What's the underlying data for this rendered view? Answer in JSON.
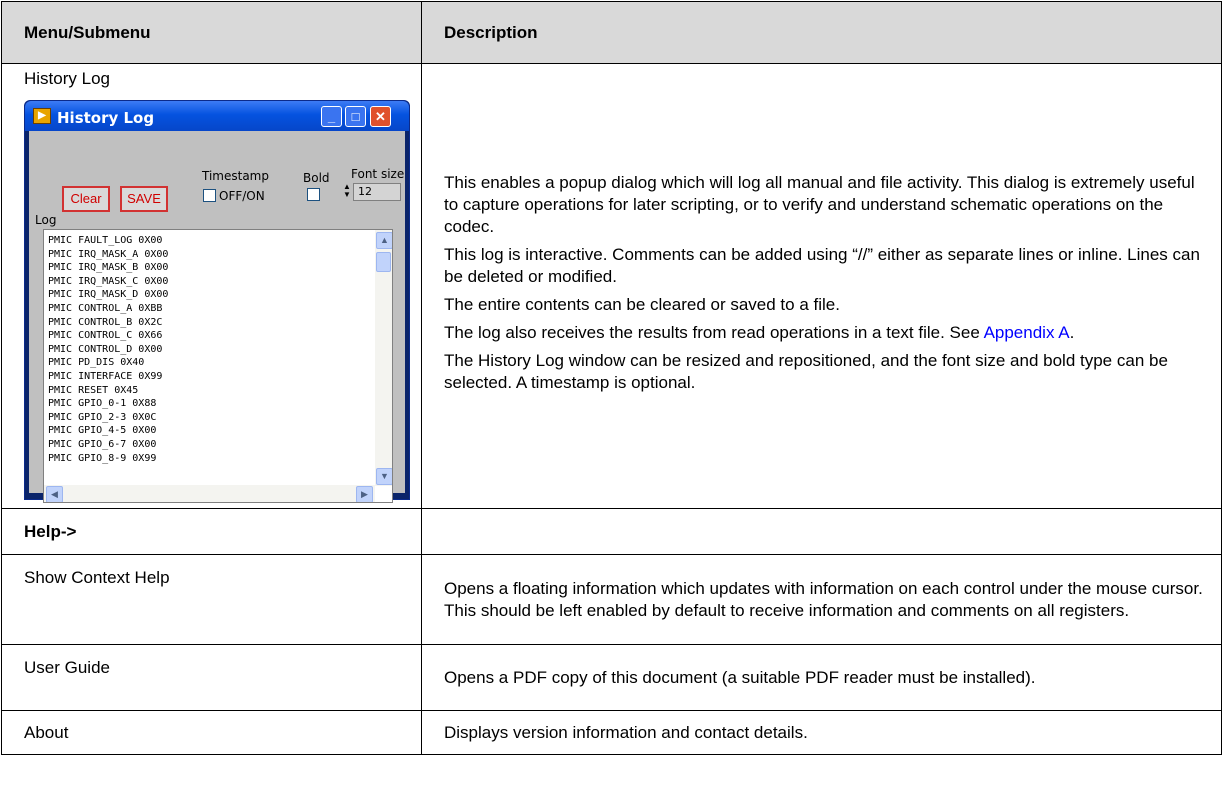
{
  "table": {
    "header": {
      "col1": "Menu/Submenu",
      "col2": "Description"
    },
    "history_row": {
      "label": "History Log",
      "paragraphs": [
        "This enables a popup dialog which will log all manual and file activity. This dialog is extremely useful to capture operations for later scripting, or to verify and understand schematic operations on the codec.",
        "This log is interactive. Comments can be added using “//” either as separate lines or inline. Lines can be deleted or modified.",
        "The entire contents can be cleared or saved to a file."
      ],
      "para4_text": "The log also receives the results from read operations in a text file. See ",
      "para4_link": "Appendix A",
      "para4_end": ".",
      "para5": "The History Log window can be resized and repositioned, and the font size and bold type can be selected. A timestamp is optional."
    },
    "help_row": {
      "label": "Help->"
    },
    "context_row": {
      "label": "Show Context Help",
      "description": "Opens a floating information which updates with information on each control under the mouse cursor. This should be left enabled by default to receive information and comments on all registers."
    },
    "guide_row": {
      "label": "User Guide",
      "description": "Opens a PDF copy of this document (a suitable PDF reader must be installed)."
    },
    "about_row": {
      "label": "About",
      "description": "Displays version information and contact details."
    }
  },
  "window": {
    "title": "History Log",
    "clear_label": "Clear",
    "save_label": "SAVE",
    "timestamp_label": "Timestamp",
    "offon_label": "OFF/ON",
    "bold_label": "Bold",
    "fontsize_label": "Font size",
    "fontsize_value": "12",
    "log_label": "Log",
    "log_lines": [
      "PMIC FAULT_LOG 0X00",
      "PMIC IRQ_MASK_A 0X00",
      "PMIC IRQ_MASK_B 0X00",
      "PMIC IRQ_MASK_C 0X00",
      "PMIC IRQ_MASK_D 0X00",
      "PMIC CONTROL_A 0XBB",
      "PMIC CONTROL_B 0X2C",
      "PMIC CONTROL_C 0X66",
      "PMIC CONTROL_D 0X00",
      "PMIC PD_DIS 0X40",
      "PMIC INTERFACE 0X99",
      "PMIC RESET 0X45",
      "PMIC GPIO_0-1 0X88",
      "PMIC GPIO_2-3 0X0C",
      "PMIC GPIO_4-5 0X00",
      "PMIC GPIO_6-7 0X00",
      "PMIC GPIO_8-9 0X99"
    ]
  },
  "icons": {
    "minimize": "minimize-icon",
    "maximize": "maximize-icon",
    "close": "close-icon",
    "app": "app-icon"
  },
  "colors": {
    "header_bg": "#d9d9d9",
    "titlebar": "#0553e0",
    "link": "#0000ff",
    "button_text": "#d00000"
  }
}
